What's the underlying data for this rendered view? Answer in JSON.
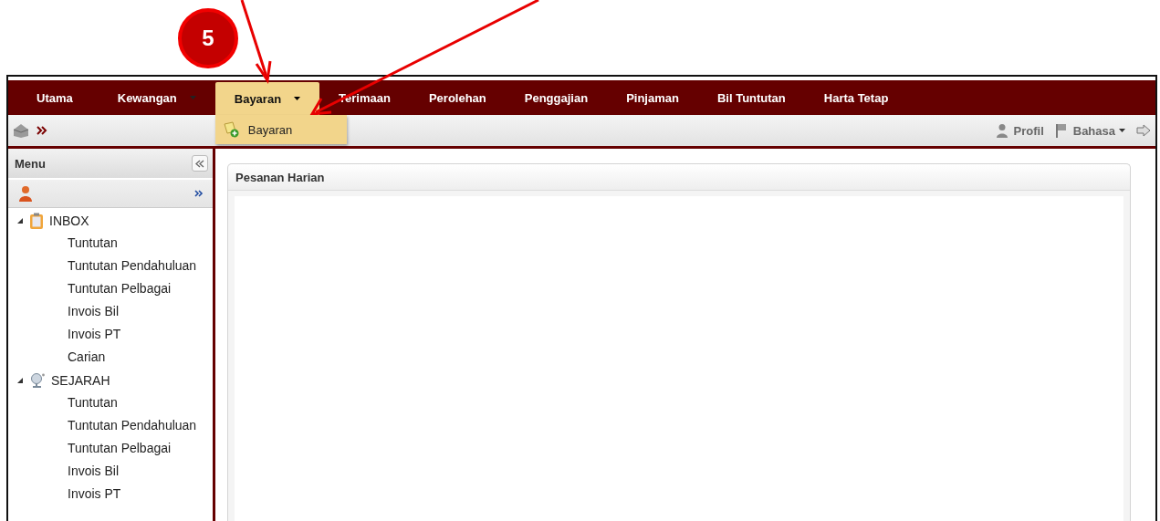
{
  "annotation": {
    "step": "5"
  },
  "nav": [
    {
      "label": "Utama",
      "has_caret": false,
      "selected": false
    },
    {
      "label": "Kewangan",
      "has_caret": true,
      "selected": false
    },
    {
      "label": "Bayaran",
      "has_caret": true,
      "selected": true,
      "dropdown": [
        {
          "label": "Bayaran"
        }
      ]
    },
    {
      "label": "Terimaan",
      "has_caret": false,
      "selected": false
    },
    {
      "label": "Perolehan",
      "has_caret": false,
      "selected": false
    },
    {
      "label": "Penggajian",
      "has_caret": false,
      "selected": false
    },
    {
      "label": "Pinjaman",
      "has_caret": false,
      "selected": false
    },
    {
      "label": "Bil Tuntutan",
      "has_caret": false,
      "selected": false
    },
    {
      "label": "Harta Tetap",
      "has_caret": false,
      "selected": false
    }
  ],
  "toolbar": {
    "profile": "Profil",
    "language": "Bahasa"
  },
  "sidebar": {
    "title": "Menu",
    "tree": [
      {
        "label": "INBOX",
        "kind": "inbox",
        "expanded": true,
        "children": [
          {
            "label": "Tuntutan"
          },
          {
            "label": "Tuntutan Pendahuluan"
          },
          {
            "label": "Tuntutan Pelbagai"
          },
          {
            "label": "Invois Bil"
          },
          {
            "label": "Invois PT"
          },
          {
            "label": "Carian"
          }
        ]
      },
      {
        "label": "SEJARAH",
        "kind": "history",
        "expanded": true,
        "children": [
          {
            "label": "Tuntutan"
          },
          {
            "label": "Tuntutan Pendahuluan"
          },
          {
            "label": "Tuntutan Pelbagai"
          },
          {
            "label": "Invois Bil"
          },
          {
            "label": "Invois PT"
          }
        ]
      }
    ]
  },
  "panel": {
    "title": "Pesanan Harian"
  }
}
